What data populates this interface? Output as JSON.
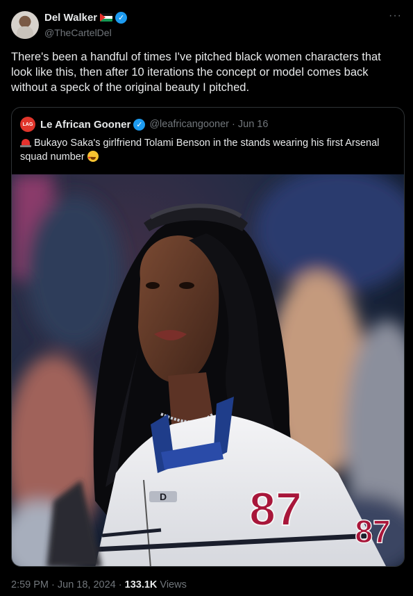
{
  "tweet": {
    "author_name": "Del Walker",
    "author_handle": "@TheCartelDel",
    "more_icon": "more-dots-icon",
    "text": "There's been a handful of times I've pitched black women characters that look like this, then after 10 iterations the concept or model comes back without a speck of the original beauty I pitched.",
    "date_time": "2:59 PM · Jun 18, 2024 · ",
    "views_count": "133.1K",
    "views_label": " Views"
  },
  "quote": {
    "avatar_text": "LAG",
    "author_name": "Le African Gooner",
    "author_handle": "@leafricangooner · Jun 16",
    "text": "Bukayo Saka's girlfriend Tolami Benson in the stands wearing his first Arsenal squad number",
    "jacket_number": "87",
    "sleeve_number": "87",
    "jacket_brand": "D"
  },
  "colors": {
    "background": "#000000",
    "verified": "#1d9bf0",
    "secondary_text": "#71767b",
    "border": "#2f3336"
  }
}
